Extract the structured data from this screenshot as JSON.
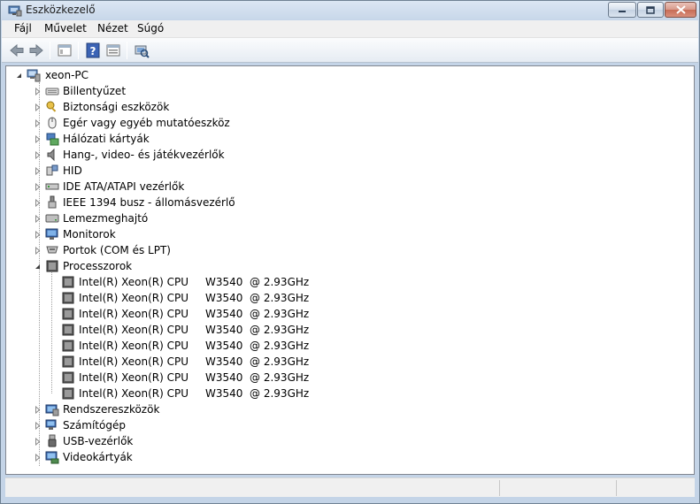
{
  "window": {
    "title": "Eszközkezelő"
  },
  "menu": [
    "Fájl",
    "Művelet",
    "Nézet",
    "Súgó"
  ],
  "toolbar": [
    "back-icon",
    "forward-icon",
    "show-hide-tree-icon",
    "help-icon",
    "properties-icon",
    "scan-hardware-icon"
  ],
  "tree": {
    "root": "xeon-PC",
    "categories": [
      {
        "label": "Billentyűzet",
        "icon": "keyboard-icon",
        "expanded": false
      },
      {
        "label": "Biztonsági eszközök",
        "icon": "security-key-icon",
        "expanded": false
      },
      {
        "label": "Egér vagy egyéb mutatóeszköz",
        "icon": "mouse-icon",
        "expanded": false
      },
      {
        "label": "Hálózati kártyák",
        "icon": "network-adapter-icon",
        "expanded": false
      },
      {
        "label": "Hang-, video- és játékvezérlők",
        "icon": "speaker-icon",
        "expanded": false
      },
      {
        "label": "HID",
        "icon": "hid-icon",
        "expanded": false
      },
      {
        "label": "IDE ATA/ATAPI vezérlők",
        "icon": "ide-controller-icon",
        "expanded": false
      },
      {
        "label": "IEEE 1394 busz - állomásvezérlő",
        "icon": "firewire-icon",
        "expanded": false
      },
      {
        "label": "Lemezmeghajtó",
        "icon": "disk-drive-icon",
        "expanded": false
      },
      {
        "label": "Monitorok",
        "icon": "monitor-icon",
        "expanded": false
      },
      {
        "label": "Portok (COM és LPT)",
        "icon": "port-icon",
        "expanded": false
      },
      {
        "label": "Processzorok",
        "icon": "processor-icon",
        "expanded": true,
        "children": [
          {
            "name": "Intel(R) Xeon(R) CPU",
            "model": "W3540  @ 2.93GHz"
          },
          {
            "name": "Intel(R) Xeon(R) CPU",
            "model": "W3540  @ 2.93GHz"
          },
          {
            "name": "Intel(R) Xeon(R) CPU",
            "model": "W3540  @ 2.93GHz"
          },
          {
            "name": "Intel(R) Xeon(R) CPU",
            "model": "W3540  @ 2.93GHz"
          },
          {
            "name": "Intel(R) Xeon(R) CPU",
            "model": "W3540  @ 2.93GHz"
          },
          {
            "name": "Intel(R) Xeon(R) CPU",
            "model": "W3540  @ 2.93GHz"
          },
          {
            "name": "Intel(R) Xeon(R) CPU",
            "model": "W3540  @ 2.93GHz"
          },
          {
            "name": "Intel(R) Xeon(R) CPU",
            "model": "W3540  @ 2.93GHz"
          }
        ]
      },
      {
        "label": "Rendszereszközök",
        "icon": "system-device-icon",
        "expanded": false
      },
      {
        "label": "Számítógép",
        "icon": "computer-icon",
        "expanded": false
      },
      {
        "label": "USB-vezérlők",
        "icon": "usb-icon",
        "expanded": false
      },
      {
        "label": "Videokártyák",
        "icon": "display-adapter-icon",
        "expanded": false
      }
    ]
  },
  "colors": {
    "accent": "#2a5b9c",
    "tree_bg": "#ffffff",
    "chrome": "#c4d4e7"
  }
}
